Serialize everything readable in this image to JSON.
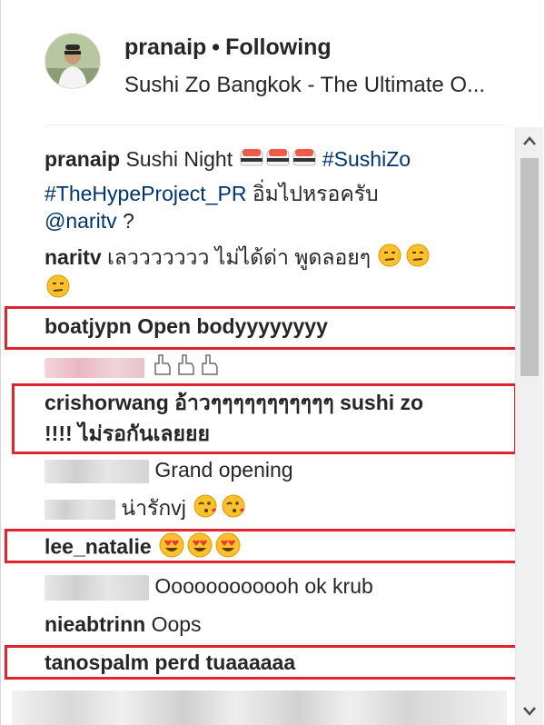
{
  "header": {
    "username": "pranaip",
    "separator": "•",
    "follow_status": "Following",
    "location": "Sushi Zo Bangkok - The Ultimate O..."
  },
  "caption": {
    "username": "pranaip",
    "text1": "Sushi Night",
    "emojis1": [
      "sushi-emoji",
      "sushi-emoji",
      "sushi-emoji"
    ],
    "hashtag1": "#SushiZo",
    "hashtag2": "#TheHypeProject_PR",
    "text2": "อิ่มไปหรอครับ",
    "mention": "@naritv",
    "text3": "?"
  },
  "comments": [
    {
      "username": "naritv",
      "text": "เลววววววว ไม่ได้ด่า พูดลอยๆ",
      "emoji": "unamused-face-emoji"
    },
    {
      "username": "boatjypn",
      "text": "Open bodyyyyyyyy",
      "highlighted": true
    },
    {
      "username": "",
      "blurred": true,
      "emoji": "pointing-up-emoji"
    },
    {
      "username": "crishorwang",
      "text": "อ้าวๆๆๆๆๆๆๆๆๆๆๆ sushi zo",
      "text_cont": "!!!! ไม่รอกันเลยยย",
      "highlighted": true
    },
    {
      "username": "",
      "blurred": true,
      "text": "Grand opening"
    },
    {
      "username": "",
      "blurred": true,
      "text": "น่ารักvj",
      "emoji": "kissing-face-emoji"
    },
    {
      "username": "lee_natalie",
      "text": "",
      "emoji": "heart-eyes-emoji",
      "highlighted": true
    },
    {
      "username": "",
      "blurred": true,
      "text": "Oooooooooooh ok krub"
    },
    {
      "username": "nieabtrinn",
      "text": "Oops"
    },
    {
      "username": "tanospalm",
      "text": "perd tuaaaaaa",
      "highlighted": true
    }
  ],
  "colors": {
    "highlight": "#e0242b",
    "hashtag": "#003569",
    "text": "#262626"
  },
  "scrollbar": {
    "up_icon": "scroll-up-arrow-icon",
    "down_icon": "scroll-down-arrow-icon"
  }
}
